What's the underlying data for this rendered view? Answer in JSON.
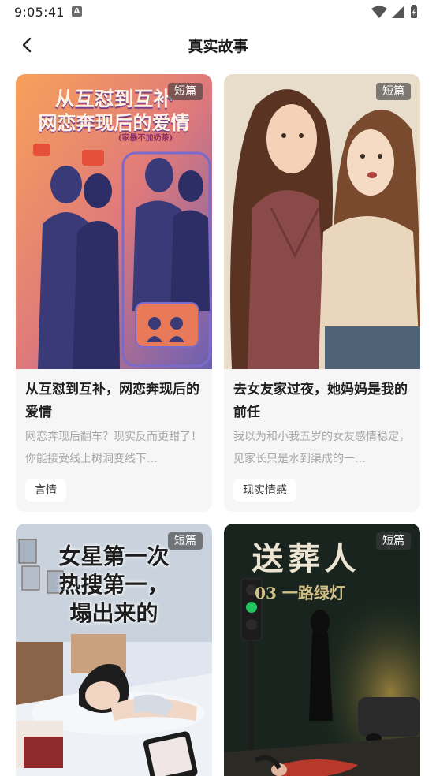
{
  "status": {
    "time": "9:05:41",
    "notif_letter": "A"
  },
  "header": {
    "title": "真实故事"
  },
  "cards": [
    {
      "badge": "短篇",
      "cover_title_line1": "从互怼到互补",
      "cover_title_line2": "网恋奔现后的爱情",
      "cover_subtitle": "(家暴不加奶茶)",
      "title": "从互怼到互补，网恋奔现后的爱情",
      "desc": "网恋奔现后翻车？现实反而更甜了！你能接受线上树洞变线下…",
      "tag": "言情"
    },
    {
      "badge": "短篇",
      "title": "去女友家过夜，她妈妈是我的前任",
      "desc": "我以为和小我五岁的女友感情稳定，见家长只是水到渠成的一…",
      "tag": "现实情感"
    },
    {
      "badge": "短篇",
      "cover_title_line1": "女星第一次",
      "cover_title_line2": "热搜第一，",
      "cover_title_line3": "塌出来的"
    },
    {
      "badge": "短篇",
      "cover_title_line1": "送葬人",
      "cover_title_line2": "03 一路绿灯"
    }
  ],
  "colors": {
    "accent_green": "#22c55e",
    "badge_bg": "#3c3c3c"
  },
  "icons": {
    "back": "chevron-left-icon",
    "wifi": "wifi-icon",
    "signal": "signal-icon",
    "battery": "battery-icon"
  }
}
